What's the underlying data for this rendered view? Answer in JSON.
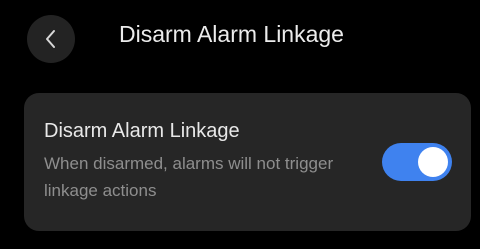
{
  "header": {
    "back_icon": "chevron-left-icon",
    "title": "Disarm Alarm Linkage"
  },
  "setting": {
    "title": "Disarm Alarm Linkage",
    "description": "When disarmed, alarms will not trigger linkage actions",
    "toggle_state": "on"
  },
  "colors": {
    "background": "#000000",
    "card": "#262626",
    "toggle_on": "#3f82ef",
    "title_text": "#ececec",
    "secondary_text": "#8e8e8e"
  }
}
